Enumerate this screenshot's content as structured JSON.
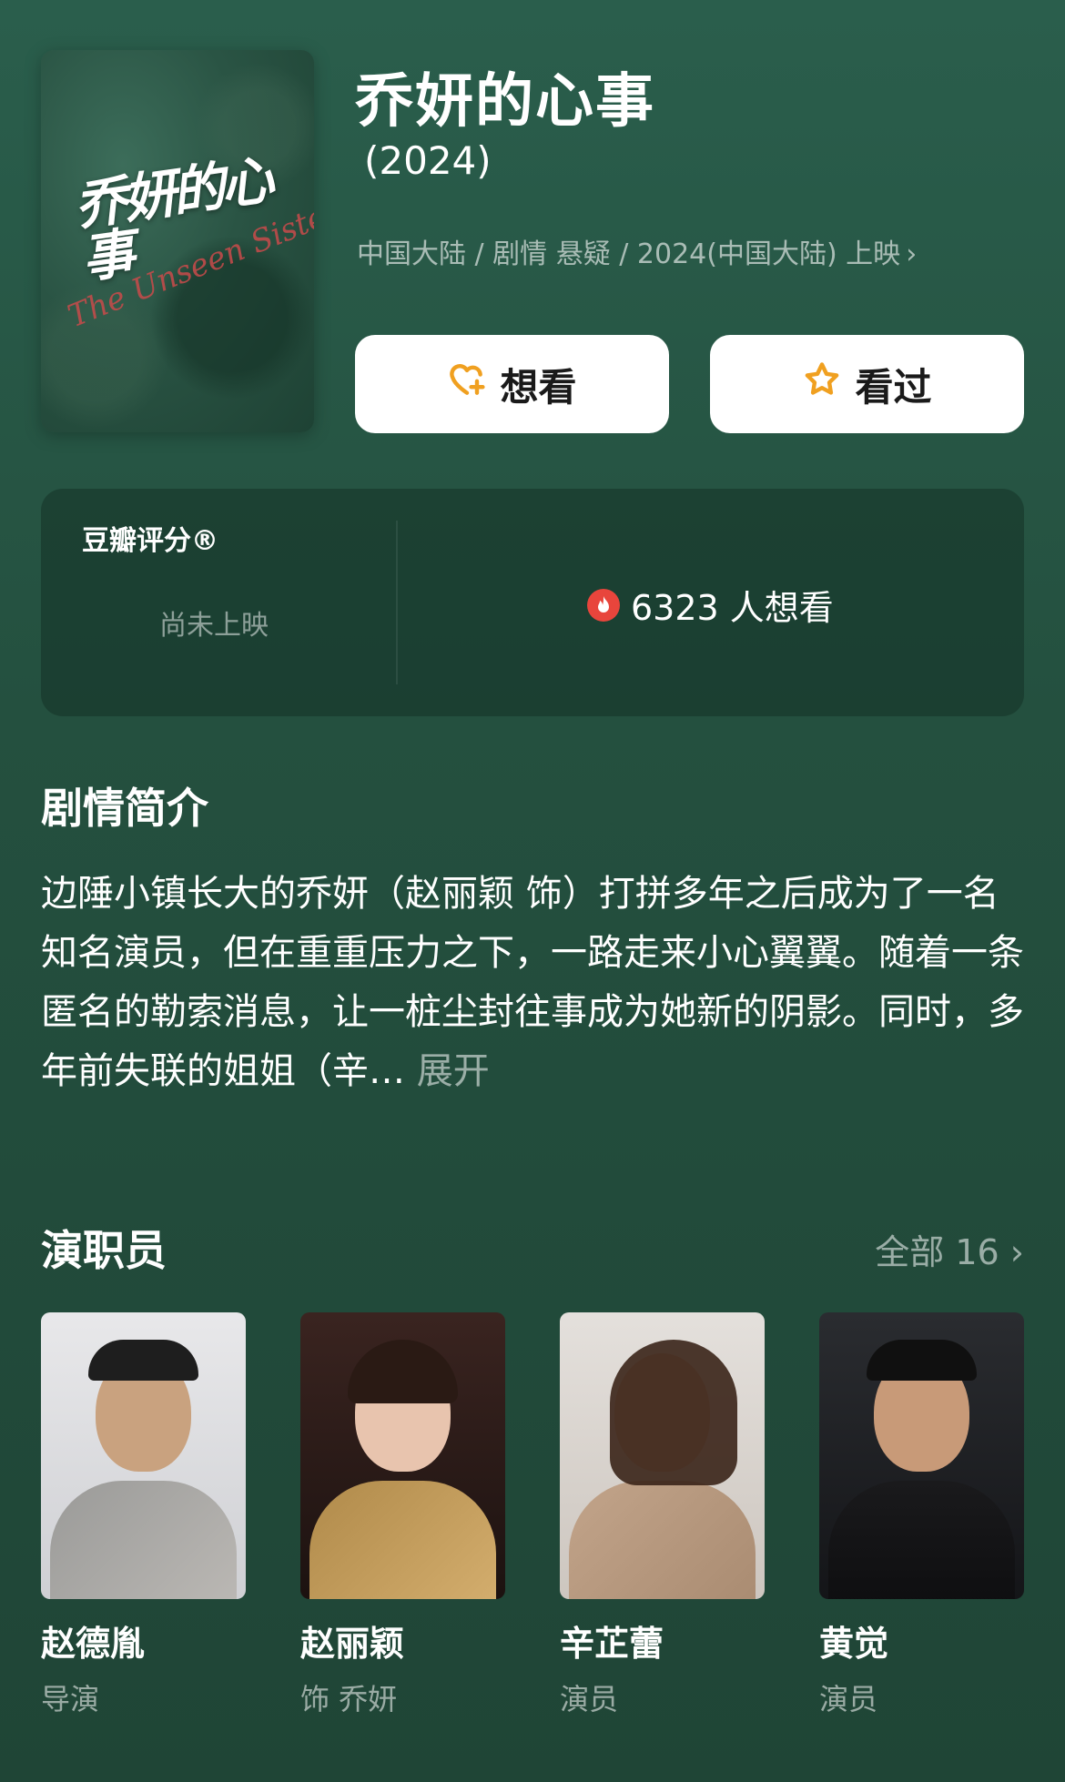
{
  "movie": {
    "poster_title": "乔妍的心事",
    "poster_subtitle": "The Unseen Sister",
    "title": "乔妍的心事",
    "year": "(2024)",
    "meta": "中国大陆 / 剧情 悬疑 / 2024(中国大陆) 上映",
    "meta_chevron": "›"
  },
  "actions": {
    "want_label": "想看",
    "want_icon": "heart-plus-icon",
    "seen_label": "看过",
    "seen_icon": "star-icon"
  },
  "rating": {
    "label": "豆瓣评分®",
    "status": "尚未上映",
    "want_count": "6323 人想看"
  },
  "synopsis": {
    "heading": "剧情简介",
    "text": "边陲小镇长大的乔妍（赵丽颖 饰）打拼多年之后成为了一名知名演员，但在重重压力之下，一路走来小心翼翼。随着一条匿名的勒索消息，让一桩尘封往事成为她新的阴影。同时，多年前失联的姐姐（辛…",
    "more_label": " 展开"
  },
  "cast_section": {
    "heading": "演职员",
    "all_label": "全部 16 ›"
  },
  "cast": [
    {
      "name": "赵德胤",
      "role": "导演"
    },
    {
      "name": "赵丽颖",
      "role": "饰 乔妍"
    },
    {
      "name": "辛芷蕾",
      "role": "演员"
    },
    {
      "name": "黄觉",
      "role": "演员"
    }
  ],
  "colors": {
    "background": "#24503f",
    "accent": "#f0a020",
    "fire": "#e8453c"
  }
}
